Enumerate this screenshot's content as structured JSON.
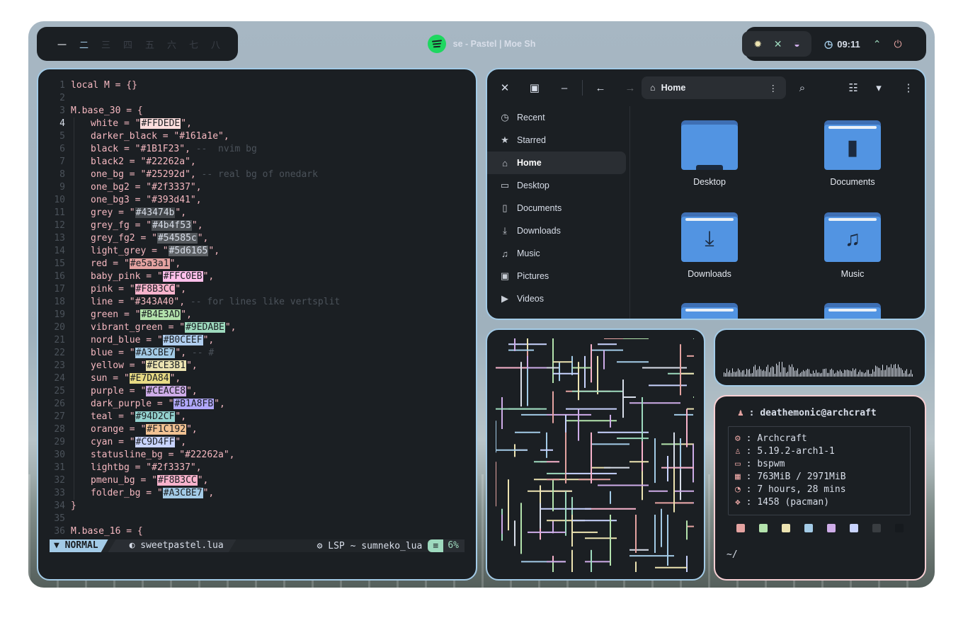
{
  "topbar": {
    "workspaces": [
      "一",
      "二",
      "三",
      "四",
      "五",
      "六",
      "七",
      "八"
    ],
    "now_playing": "se - Pastel | Moe Sh",
    "clock": "09:11"
  },
  "editor": {
    "lines": [
      {
        "n": "1",
        "t": "local M = {}"
      },
      {
        "n": "2",
        "t": ""
      },
      {
        "n": "3",
        "t": "M.base_30 = {"
      },
      {
        "n": "4",
        "k": "white",
        "v": "FFDEDE",
        "c": "#ffdede"
      },
      {
        "n": "5",
        "k": "darker_black",
        "v": "161a1e",
        "c": ""
      },
      {
        "n": "6",
        "k": "black",
        "v": "1B1F23",
        "c": "",
        "cm": " --  nvim bg"
      },
      {
        "n": "7",
        "k": "black2",
        "v": "22262a",
        "c": ""
      },
      {
        "n": "8",
        "k": "one_bg",
        "v": "25292d",
        "c": "",
        "cm": " -- real bg of onedark"
      },
      {
        "n": "9",
        "k": "one_bg2",
        "v": "2f3337",
        "c": ""
      },
      {
        "n": "10",
        "k": "one_bg3",
        "v": "393d41",
        "c": ""
      },
      {
        "n": "11",
        "k": "grey",
        "v": "43474b",
        "c": "#43474b",
        "d": 1
      },
      {
        "n": "12",
        "k": "grey_fg",
        "v": "4b4f53",
        "c": "#4b4f53",
        "d": 1
      },
      {
        "n": "13",
        "k": "grey_fg2",
        "v": "54585c",
        "c": "#54585c",
        "d": 1
      },
      {
        "n": "14",
        "k": "light_grey",
        "v": "5d6165",
        "c": "#5d6165",
        "d": 1
      },
      {
        "n": "15",
        "k": "red",
        "v": "e5a3a1",
        "c": "#e5a3a1"
      },
      {
        "n": "16",
        "k": "baby_pink",
        "v": "FFC0EB",
        "c": "#ffc0eb"
      },
      {
        "n": "17",
        "k": "pink",
        "v": "F8B3CC",
        "c": "#f8b3cc"
      },
      {
        "n": "18",
        "k": "line",
        "v": "343A40",
        "c": "",
        "cm": " -- for lines like vertsplit"
      },
      {
        "n": "19",
        "k": "green",
        "v": "B4E3AD",
        "c": "#b4e3ad"
      },
      {
        "n": "20",
        "k": "vibrant_green",
        "v": "9EDABE",
        "c": "#9edabe"
      },
      {
        "n": "21",
        "k": "nord_blue",
        "v": "B0CEEF",
        "c": "#b0ceef"
      },
      {
        "n": "22",
        "k": "blue",
        "v": "A3CBE7",
        "c": "#a3cbe7",
        "cm": " -- #"
      },
      {
        "n": "23",
        "k": "yellow",
        "v": "ECE3B1",
        "c": "#ece3b1"
      },
      {
        "n": "24",
        "k": "sun",
        "v": "E7DA84",
        "c": "#e7da84"
      },
      {
        "n": "25",
        "k": "purple",
        "v": "CEACE8",
        "c": "#ceace8"
      },
      {
        "n": "26",
        "k": "dark_purple",
        "v": "B1A8FB",
        "c": "#b1a8fb"
      },
      {
        "n": "27",
        "k": "teal",
        "v": "94D2CF",
        "c": "#94d2cf"
      },
      {
        "n": "28",
        "k": "orange",
        "v": "F1C192",
        "c": "#f1c192"
      },
      {
        "n": "29",
        "k": "cyan",
        "v": "C9D4FF",
        "c": "#c9d4ff"
      },
      {
        "n": "30",
        "k": "statusline_bg",
        "v": "22262a",
        "c": ""
      },
      {
        "n": "31",
        "k": "lightbg",
        "v": "2f3337",
        "c": ""
      },
      {
        "n": "32",
        "k": "pmenu_bg",
        "v": "F8B3CC",
        "c": "#f8b3cc"
      },
      {
        "n": "33",
        "k": "folder_bg",
        "v": "A3CBE7",
        "c": "#a3cbe7"
      },
      {
        "n": "34",
        "t": "}"
      },
      {
        "n": "35",
        "t": ""
      },
      {
        "n": "36",
        "t": "M.base_16 = {"
      }
    ],
    "current_line": "4",
    "status": {
      "mode": "NORMAL",
      "file": "sweetpastel.lua",
      "lsp": "LSP ~ sumneko_lua",
      "percent": "6%"
    }
  },
  "file_manager": {
    "path": "Home",
    "sidebar": [
      {
        "icon": "clock-icon",
        "glyph": "◷",
        "label": "Recent"
      },
      {
        "icon": "star-icon",
        "glyph": "★",
        "label": "Starred"
      },
      {
        "icon": "home-icon",
        "glyph": "⌂",
        "label": "Home",
        "selected": true
      },
      {
        "icon": "desktop-icon",
        "glyph": "▭",
        "label": "Desktop"
      },
      {
        "icon": "document-icon",
        "glyph": "▯",
        "label": "Documents"
      },
      {
        "icon": "download-icon",
        "glyph": "⤓",
        "label": "Downloads"
      },
      {
        "icon": "music-icon",
        "glyph": "♫",
        "label": "Music"
      },
      {
        "icon": "picture-icon",
        "glyph": "▣",
        "label": "Pictures"
      },
      {
        "icon": "video-icon",
        "glyph": "▶",
        "label": "Videos"
      }
    ],
    "folders": [
      {
        "label": "Desktop",
        "icon": "folder-icon",
        "glyph": ""
      },
      {
        "label": "Documents",
        "icon": "folder-documents-icon",
        "glyph": "▮"
      },
      {
        "label": "Downloads",
        "icon": "folder-download-icon",
        "glyph": "⤓"
      },
      {
        "label": "Music",
        "icon": "folder-music-icon",
        "glyph": "♫"
      }
    ]
  },
  "fetch": {
    "user": "deathemonic@archcraft",
    "rows": [
      {
        "icon": "gear-icon",
        "glyph": "⚙",
        "text": "Archcraft"
      },
      {
        "icon": "linux-icon",
        "glyph": "♙",
        "text": "5.19.2-arch1-1"
      },
      {
        "icon": "window-icon",
        "glyph": "▭",
        "text": "bspwm"
      },
      {
        "icon": "memory-icon",
        "glyph": "▦",
        "text": "763MiB / 2971MiB"
      },
      {
        "icon": "uptime-icon",
        "glyph": "◔",
        "text": "7 hours, 28 mins"
      },
      {
        "icon": "package-icon",
        "glyph": "❖",
        "text": "1458 (pacman)"
      }
    ],
    "swatches": [
      "#e5a3a1",
      "#b4e3ad",
      "#ece3b1",
      "#a3cbe7",
      "#ceace8",
      "#c9d4ff",
      "#393d41",
      "#161a1e"
    ],
    "prompt": "~/"
  },
  "colors": {
    "bg": "#1b1f23",
    "accent": "#a3cbe7",
    "fg": "#d8dee9",
    "green": "#9edabe",
    "red": "#e5a3a1",
    "pink_border": "#f8cfd3"
  }
}
